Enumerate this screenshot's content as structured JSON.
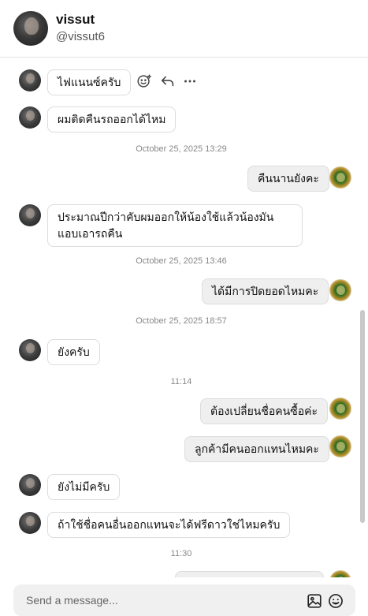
{
  "header": {
    "name": "vissut",
    "handle": "@vissut6"
  },
  "messages": [
    {
      "side": "them",
      "text": "ไฟแนนซ์ครับ"
    },
    {
      "side": "them",
      "text": "ผมติดคืนรถออกได้ไหม"
    },
    {
      "timestamp": "October 25, 2025 13:29"
    },
    {
      "side": "me",
      "text": "คืนนานยังคะ"
    },
    {
      "side": "them",
      "text": "ประมาณปีกว่าคับผมออกให้น้องใช้แล้วน้องมันแอบเอารถคืน"
    },
    {
      "timestamp": "October 25, 2025 13:46"
    },
    {
      "side": "me",
      "text": "ได้มีการปิดยอดไหมคะ"
    },
    {
      "timestamp": "October 25, 2025 18:57"
    },
    {
      "side": "them",
      "text": "ยังครับ"
    },
    {
      "timestamp": "11:14"
    },
    {
      "side": "me",
      "text": "ต้องเปลี่ยนชื่อคนซื้อค่ะ"
    },
    {
      "side": "me",
      "text": "ลูกค้ามีคนออกแทนไหมคะ"
    },
    {
      "side": "them",
      "text": "ยังไม่มีครับ"
    },
    {
      "side": "them",
      "text": "ถ้าใช้ชื่อคนอื่นออกแทนจะได้ฟรีดาวใช่ไหมครับ"
    },
    {
      "timestamp": "11:30"
    }
  ],
  "composer": {
    "placeholder": "Send a message..."
  },
  "icons": {
    "react": "add-reaction-icon",
    "reply": "reply-icon",
    "more": "more-options-icon",
    "image": "image-icon",
    "emoji": "emoji-icon"
  }
}
